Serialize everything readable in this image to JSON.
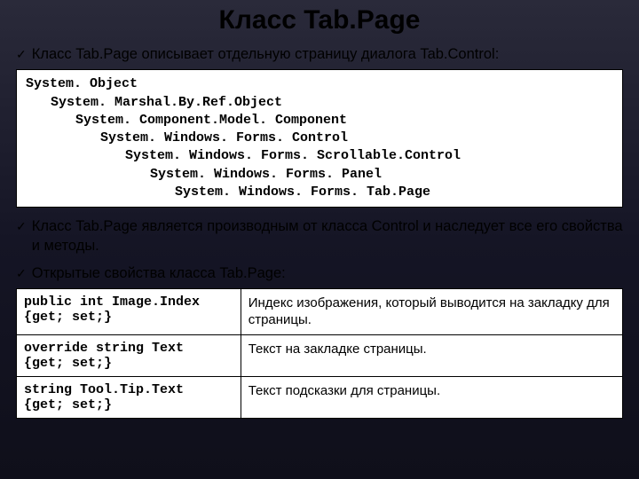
{
  "title": "Класс Tab.Page",
  "bullets": {
    "b1": "Класс Tab.Page описывает отдельную страницу диалога Tab.Control:",
    "b2": "Класс Tab.Page является производным от класса Control  и наследует все его свойства и методы.",
    "b3": "Открытые свойства класса Tab.Page:"
  },
  "hierarchy": {
    "l0": "System. Object",
    "l1": "System. Marshal.By.Ref.Object",
    "l2": "System. Component.Model. Component",
    "l3": "System. Windows. Forms. Control",
    "l4": "System. Windows. Forms. Scrollable.Control",
    "l5": "System. Windows. Forms. Panel",
    "l6": "System. Windows. Forms. Tab.Page"
  },
  "props": [
    {
      "sig": "public int Image.Index\n{get; set;}",
      "desc": "Индекс изображения, который выводится на закладку для страницы."
    },
    {
      "sig": "override string Text\n{get; set;}",
      "desc": "Текст на закладке страницы."
    },
    {
      "sig": "string Tool.Tip.Text\n{get; set;}",
      "desc": "Текст подсказки для страницы."
    }
  ]
}
